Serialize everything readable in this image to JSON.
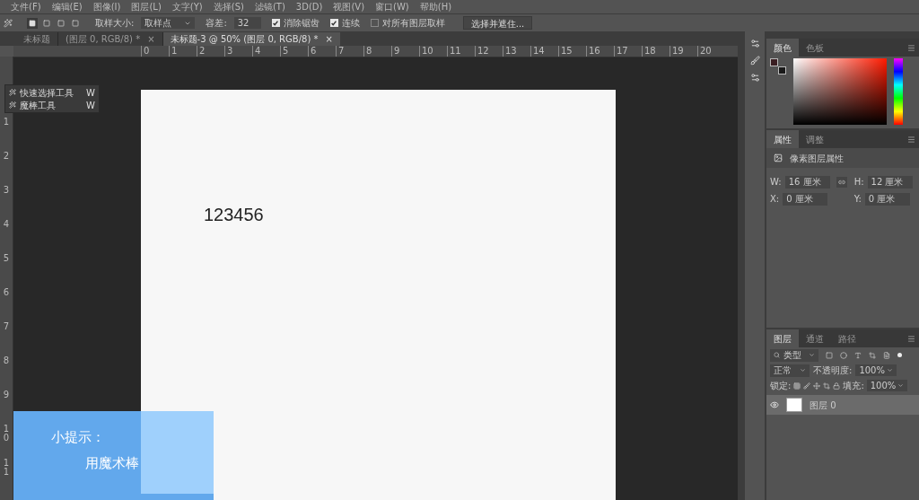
{
  "menu_bar": [
    "文件(F)",
    "编辑(E)",
    "图像(I)",
    "图层(L)",
    "文字(Y)",
    "选择(S)",
    "滤镜(T)",
    "3D(D)",
    "视图(V)",
    "窗口(W)",
    "帮助(H)"
  ],
  "options_bar": {
    "modes": [
      {
        "selected": true
      },
      {
        "selected": false
      },
      {
        "selected": false
      },
      {
        "selected": false
      }
    ],
    "sample_size_label": "取样大小:",
    "sample_size": "取样点",
    "tolerance_label": "容差:",
    "tolerance": "32",
    "checkboxes": [
      {
        "label": "消除锯齿",
        "checked": true
      },
      {
        "label": "连续",
        "checked": true
      },
      {
        "label": "对所有图层取样",
        "checked": false
      }
    ],
    "button": "选择并遮住..."
  },
  "document_tabs": [
    {
      "title": "未标题",
      "selected": false
    },
    {
      "title": "(图层 0, RGB/8) *",
      "selected": false
    },
    {
      "title": "未标题-3 @ 50% (图层 0, RGB/8) *",
      "selected": true
    }
  ],
  "close_glyph": "×",
  "ruler_h": [
    "0",
    "1",
    "2",
    "3",
    "4",
    "5",
    "6",
    "7",
    "8",
    "9",
    "10",
    "11",
    "12",
    "13",
    "14",
    "15",
    "16",
    "17",
    "18",
    "19",
    "20"
  ],
  "ruler_v": [
    "1",
    "2",
    "3",
    "4",
    "5",
    "6",
    "7",
    "8",
    "9",
    "10",
    "11"
  ],
  "tool_flyout": [
    {
      "label": "快速选择工具",
      "shortcut": "W"
    },
    {
      "label": "魔棒工具",
      "shortcut": "W"
    }
  ],
  "canvas_text": "123456",
  "tip": {
    "title": "小提示：",
    "body": "用魔术棒"
  },
  "color_panel": {
    "tabs": [
      {
        "label": "颜色",
        "selected": true
      },
      {
        "label": "色板",
        "selected": false
      }
    ]
  },
  "properties_panel": {
    "tabs": [
      {
        "label": "属性",
        "selected": true
      },
      {
        "label": "调整",
        "selected": false
      }
    ],
    "heading": "像素图层属性",
    "fields": [
      {
        "label": "W:",
        "value": "16 厘米"
      },
      {
        "label": "H:",
        "value": "12 厘米"
      },
      {
        "label": "X:",
        "value": "0 厘米"
      },
      {
        "label": "Y:",
        "value": "0 厘米"
      }
    ]
  },
  "layers_panel": {
    "tabs": [
      {
        "label": "图层",
        "selected": true
      },
      {
        "label": "通道",
        "selected": false
      },
      {
        "label": "路径",
        "selected": false
      }
    ],
    "filter": "类型",
    "blend_mode": "正常",
    "opacity_label": "不透明度:",
    "opacity": "100%",
    "lock_label": "锁定:",
    "fill_label": "填充:",
    "fill": "100%",
    "layers": [
      {
        "name": "图层 0",
        "visible": true,
        "selected": true
      }
    ]
  }
}
